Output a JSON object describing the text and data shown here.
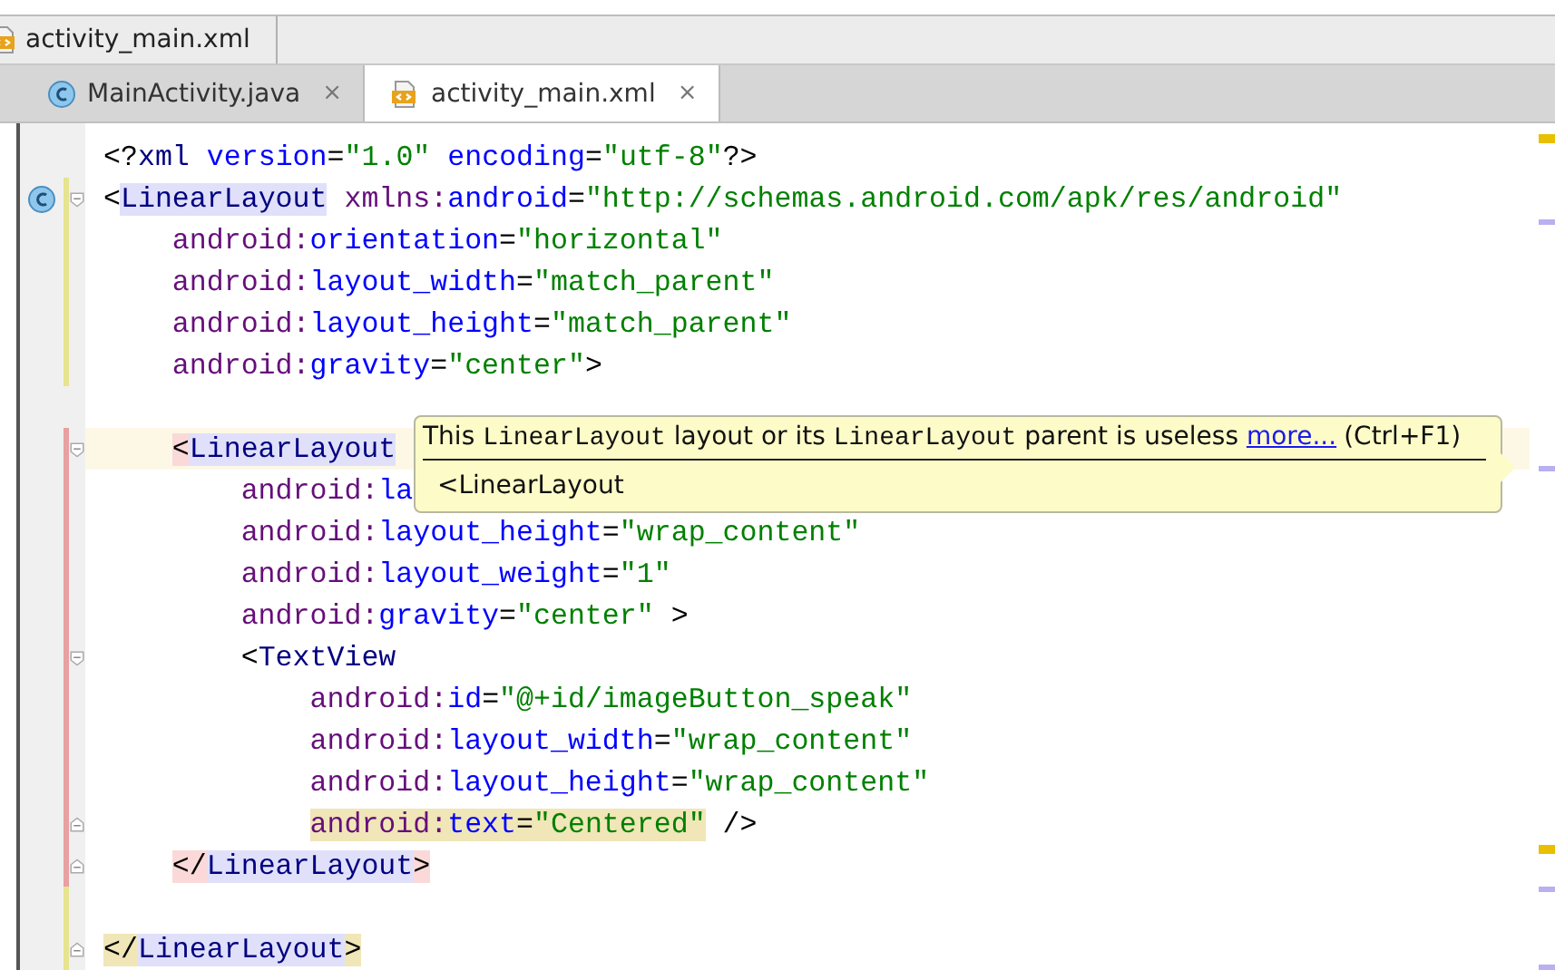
{
  "breadcrumb": {
    "file": "activity_main.xml"
  },
  "tabs": [
    {
      "label": "MainActivity.java",
      "kind": "java",
      "selected": false,
      "close": "×"
    },
    {
      "label": "activity_main.xml",
      "kind": "xml",
      "selected": true,
      "close": "×"
    }
  ],
  "editor": {
    "lines": [
      {
        "current": false,
        "tokens": [
          {
            "kind": "plain",
            "text": "<?"
          },
          {
            "kind": "tag",
            "text": "xml"
          },
          {
            "kind": "attr",
            "text": " version"
          },
          {
            "kind": "plain",
            "text": "="
          },
          {
            "kind": "value",
            "text": "\"1.0\""
          },
          {
            "kind": "attr",
            "text": " encoding"
          },
          {
            "kind": "plain",
            "text": "="
          },
          {
            "kind": "value",
            "text": "\"utf-8\""
          },
          {
            "kind": "plain",
            "text": "?>"
          }
        ]
      },
      {
        "modified": true,
        "fold_start": true,
        "class_icon": true,
        "current": false,
        "tokens": [
          {
            "kind": "plain",
            "text": "<"
          },
          {
            "kind": "tag",
            "text": "LinearLayout",
            "matched": true
          },
          {
            "kind": "ns",
            "text": " xmlns:"
          },
          {
            "kind": "attr",
            "text": "android"
          },
          {
            "kind": "plain",
            "text": "="
          },
          {
            "kind": "value",
            "text": "\"http://schemas.android.com/apk/res/android\""
          }
        ],
        "children": [
          {
            "modified": true,
            "current": false,
            "tokens": [
              {
                "kind": "ns",
                "text": "android:"
              },
              {
                "kind": "attr",
                "text": "orientation"
              },
              {
                "kind": "plain",
                "text": "="
              },
              {
                "kind": "value",
                "text": "\"horizontal\""
              }
            ]
          },
          {
            "modified": true,
            "current": false,
            "tokens": [
              {
                "kind": "ns",
                "text": "android:"
              },
              {
                "kind": "attr",
                "text": "layout_width"
              },
              {
                "kind": "plain",
                "text": "="
              },
              {
                "kind": "value",
                "text": "\"match_parent\""
              }
            ]
          },
          {
            "modified": true,
            "current": false,
            "tokens": [
              {
                "kind": "ns",
                "text": "android:"
              },
              {
                "kind": "attr",
                "text": "layout_height"
              },
              {
                "kind": "plain",
                "text": "="
              },
              {
                "kind": "value",
                "text": "\"match_parent\""
              }
            ]
          },
          {
            "modified": true,
            "current": false,
            "tokens": [
              {
                "kind": "ns",
                "text": "android:"
              },
              {
                "kind": "attr",
                "text": "gravity"
              },
              {
                "kind": "plain",
                "text": "="
              },
              {
                "kind": "value",
                "text": "\"center\""
              },
              {
                "kind": "plain",
                "text": ">"
              }
            ]
          },
          {
            "current": false
          },
          {
            "added": true,
            "fold_start": true,
            "current": true,
            "tokens": [
              {
                "kind": "plain",
                "text": "<",
                "error": true
              },
              {
                "kind": "tag",
                "text": "LinearLayout",
                "matched": true
              }
            ],
            "children": [
              {
                "added": true,
                "current": false,
                "tokens": [
                  {
                    "kind": "ns",
                    "text": "android:"
                  },
                  {
                    "kind": "attr",
                    "text": "la"
                  }
                ]
              },
              {
                "added": true,
                "current": false,
                "tokens": [
                  {
                    "kind": "ns",
                    "text": "android:"
                  },
                  {
                    "kind": "attr",
                    "text": "layout_height"
                  },
                  {
                    "kind": "plain",
                    "text": "="
                  },
                  {
                    "kind": "value",
                    "text": "\"wrap_content\""
                  }
                ]
              },
              {
                "added": true,
                "current": false,
                "tokens": [
                  {
                    "kind": "ns",
                    "text": "android:"
                  },
                  {
                    "kind": "attr",
                    "text": "layout_weight"
                  },
                  {
                    "kind": "plain",
                    "text": "="
                  },
                  {
                    "kind": "value",
                    "text": "\"1\""
                  }
                ]
              },
              {
                "added": true,
                "current": false,
                "tokens": [
                  {
                    "kind": "ns",
                    "text": "android:"
                  },
                  {
                    "kind": "attr",
                    "text": "gravity"
                  },
                  {
                    "kind": "plain",
                    "text": "="
                  },
                  {
                    "kind": "value",
                    "text": "\"center\""
                  },
                  {
                    "kind": "plain",
                    "text": " >"
                  }
                ]
              },
              {
                "added": true,
                "fold_start": true,
                "current": false,
                "tokens": [
                  {
                    "kind": "plain",
                    "text": "<"
                  },
                  {
                    "kind": "tag",
                    "text": "TextView"
                  }
                ],
                "children": [
                  {
                    "added": true,
                    "current": false,
                    "tokens": [
                      {
                        "kind": "ns",
                        "text": "android:"
                      },
                      {
                        "kind": "attr",
                        "text": "id"
                      },
                      {
                        "kind": "plain",
                        "text": "="
                      },
                      {
                        "kind": "value",
                        "text": "\"@+id/imageButton_speak\""
                      }
                    ]
                  },
                  {
                    "added": true,
                    "current": false,
                    "tokens": [
                      {
                        "kind": "ns",
                        "text": "android:"
                      },
                      {
                        "kind": "attr",
                        "text": "layout_width"
                      },
                      {
                        "kind": "plain",
                        "text": "="
                      },
                      {
                        "kind": "value",
                        "text": "\"wrap_content\""
                      }
                    ]
                  },
                  {
                    "added": true,
                    "current": false,
                    "tokens": [
                      {
                        "kind": "ns",
                        "text": "android:"
                      },
                      {
                        "kind": "attr",
                        "text": "layout_height"
                      },
                      {
                        "kind": "plain",
                        "text": "="
                      },
                      {
                        "kind": "value",
                        "text": "\"wrap_content\""
                      }
                    ]
                  },
                  {
                    "added": true,
                    "fold_end": true,
                    "current": false,
                    "tokens": [
                      {
                        "kind": "ns",
                        "text": "android:",
                        "marked": true
                      },
                      {
                        "kind": "attr",
                        "text": "text",
                        "marked": true
                      },
                      {
                        "kind": "plain",
                        "text": "=",
                        "marked": true
                      },
                      {
                        "kind": "value",
                        "text": "\"Centered\"",
                        "marked": true
                      },
                      {
                        "kind": "plain",
                        "text": " />"
                      }
                    ]
                  }
                ]
              }
            ]
          },
          {
            "added": true,
            "fold_end": true,
            "current": false,
            "tokens": [
              {
                "kind": "plain",
                "text": "</",
                "error": true
              },
              {
                "kind": "tag",
                "text": "LinearLayout",
                "matched": true
              },
              {
                "kind": "plain",
                "text": ">",
                "error": true
              }
            ]
          },
          {
            "modified": true,
            "current": false
          }
        ]
      },
      {
        "modified": true,
        "fold_end": true,
        "current": false,
        "tokens": [
          {
            "kind": "plain",
            "text": "</",
            "marked": true
          },
          {
            "kind": "tag",
            "text": "LinearLayout",
            "matched": true
          },
          {
            "kind": "plain",
            "text": ">",
            "marked": true
          }
        ]
      }
    ]
  },
  "tooltip": {
    "message": [
      {
        "kind": "plain",
        "text": "This "
      },
      {
        "kind": "code",
        "text": "LinearLayout"
      },
      {
        "kind": "plain",
        "text": " layout or its "
      },
      {
        "kind": "code",
        "text": "LinearLayout"
      },
      {
        "kind": "plain",
        "text": " parent is useless "
      }
    ],
    "link": "more...",
    "shortcut": "(Ctrl+F1)",
    "detail": "<LinearLayout"
  }
}
